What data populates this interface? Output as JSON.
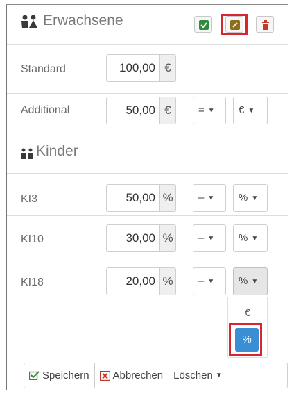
{
  "header": {
    "title": "Erwachsene",
    "icons": [
      "adults-icon",
      "check-icon",
      "edit-icon",
      "trash-icon"
    ],
    "colors": {
      "check": "#2e8b3c",
      "edit": "#8a6d20",
      "trash": "#c0392b",
      "highlight": "#d9252f"
    }
  },
  "adults": {
    "standard": {
      "label": "Standard",
      "value": "100,00",
      "unit": "€"
    },
    "additional": {
      "label": "Additional",
      "value": "50,00",
      "unit": "€",
      "operator": "=",
      "type": "€"
    }
  },
  "children": {
    "title": "Kinder",
    "rows": [
      {
        "label": "KI3",
        "value": "50,00",
        "unit": "%",
        "operator": "–",
        "type": "%"
      },
      {
        "label": "KI10",
        "value": "30,00",
        "unit": "%",
        "operator": "–",
        "type": "%"
      },
      {
        "label": "KI18",
        "value": "20,00",
        "unit": "%",
        "operator": "–",
        "type": "%"
      }
    ]
  },
  "dropdown": {
    "options": [
      "€",
      "%"
    ],
    "selected": "%",
    "active_color": "#3a8ed4"
  },
  "footer": {
    "save": "Speichern",
    "cancel": "Abbrechen",
    "delete": "Löschen"
  }
}
